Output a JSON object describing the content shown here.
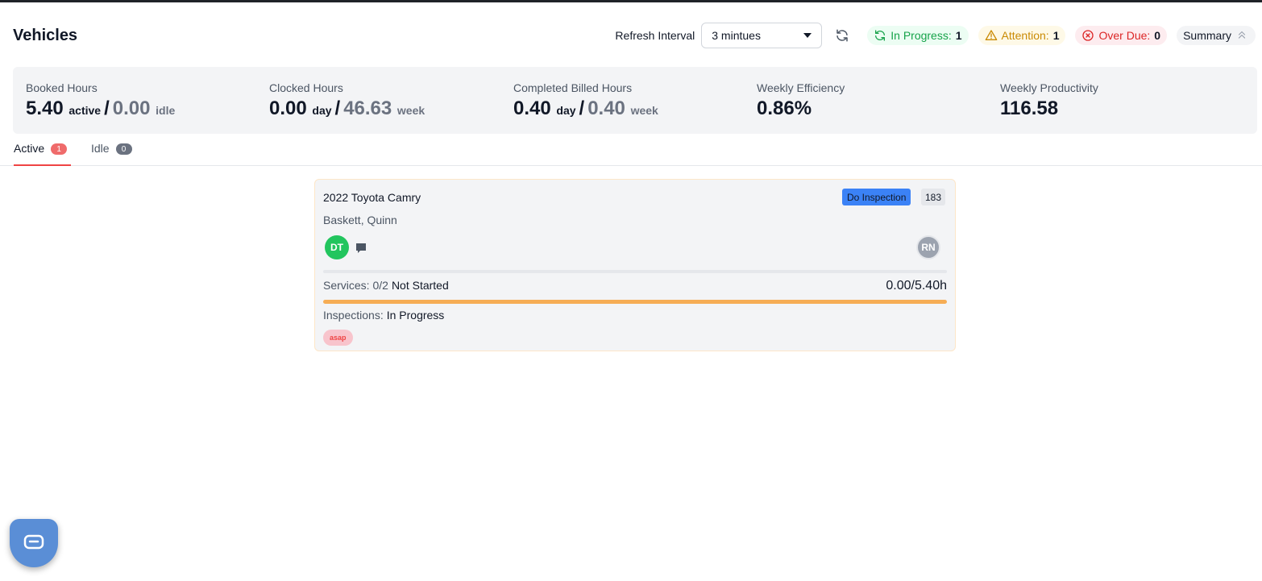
{
  "header": {
    "title": "Vehicles",
    "refresh_label": "Refresh Interval",
    "refresh_value": "3 mintues",
    "refresh_icon": "refresh-icon",
    "badges": {
      "in_progress": {
        "label": "In Progress:",
        "count": "1",
        "icon": "sync-icon",
        "color": "#16a34a"
      },
      "attention": {
        "label": "Attention:",
        "count": "1",
        "icon": "warning-icon",
        "color": "#ca8a04"
      },
      "overdue": {
        "label": "Over Due:",
        "count": "0",
        "icon": "x-circle-icon",
        "color": "#dc2626"
      }
    },
    "summary_label": "Summary",
    "summary_icon": "chevrons-up-icon"
  },
  "stats": {
    "booked": {
      "label": "Booked Hours",
      "value1": "5.40",
      "unit1": "active",
      "value2": "0.00",
      "unit2": "idle"
    },
    "clocked": {
      "label": "Clocked Hours",
      "value1": "0.00",
      "unit1": "day",
      "value2": "46.63",
      "unit2": "week"
    },
    "billed": {
      "label": "Completed Billed Hours",
      "value1": "0.40",
      "unit1": "day",
      "value2": "0.40",
      "unit2": "week"
    },
    "efficiency": {
      "label": "Weekly Efficiency",
      "value": "0.86%"
    },
    "productivity": {
      "label": "Weekly Productivity",
      "value": "116.58"
    }
  },
  "tabs": [
    {
      "label": "Active",
      "count": "1",
      "active": true
    },
    {
      "label": "Idle",
      "count": "0",
      "active": false
    }
  ],
  "card": {
    "vehicle": "2022 Toyota Camry",
    "status": "Do Inspection",
    "number": "183",
    "customer": "Baskett, Quinn",
    "technician_initials": "DT",
    "advisor_initials": "RN",
    "chat_icon": "comment-icon",
    "services_label": "Services: 0/2",
    "services_status": "Not Started",
    "hours": "0.00/5.40h",
    "hours_progress": 0,
    "inspections_label": "Inspections:",
    "inspections_status": "In Progress",
    "tag": "asap"
  },
  "chat_widget_icon": "chat-bubble-icon",
  "colors": {
    "accent_red": "#ef4444",
    "status_blue": "#3b82f6",
    "progress_orange": "#f6ad55",
    "avatar_green": "#22c55e"
  }
}
